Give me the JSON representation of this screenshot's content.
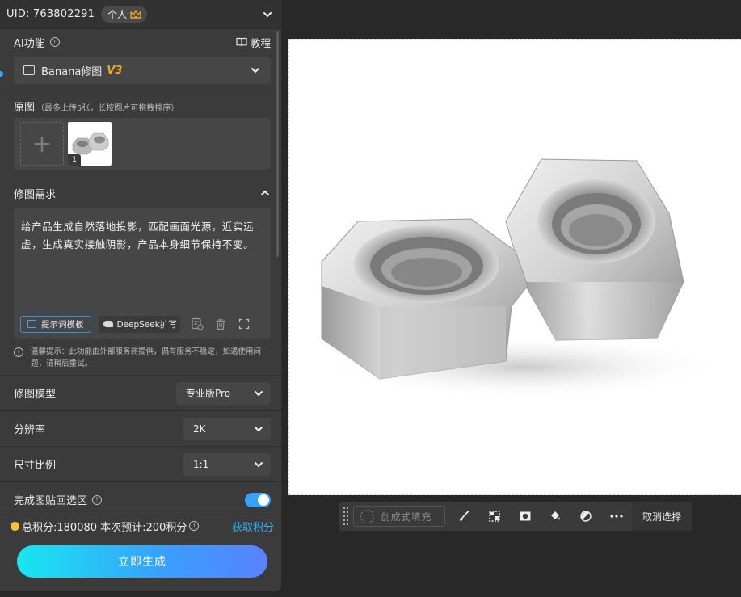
{
  "header": {
    "uid_text": "UID: 763802291",
    "badge_label": "个人"
  },
  "ai": {
    "title": "AI功能",
    "tutorial_label": "教程",
    "model_name": "Banana修图",
    "model_version": "V3"
  },
  "original": {
    "title": "原图",
    "hint": "（最多上传5张，长按图片可拖拽排序）",
    "images": [
      {
        "index": "1"
      }
    ]
  },
  "requirement": {
    "title": "修图需求",
    "text": "给产品生成自然落地投影，匹配画面光源，近实远虚，生成真实接触阴影，产品本身细节保持不变。",
    "template_label": "提示词模板",
    "deepseek_label": "DeepSeek扩写"
  },
  "notice": {
    "text": "温馨提示：此功能由外部服务商提供，偶有服务不稳定，如遇使用问题，请稍后重试。"
  },
  "options": {
    "model_label": "修图模型",
    "model_value": "专业版Pro",
    "resolution_label": "分辨率",
    "resolution_value": "2K",
    "ratio_label": "尺寸比例",
    "ratio_value": "1:1",
    "paste_back_label": "完成图贴回选区",
    "paste_back_on": true
  },
  "footer": {
    "points_text": "总积分:180080  本次预计:200积分",
    "get_points_label": "获取积分",
    "generate_label": "立即生成"
  },
  "toolbar": {
    "fill_label": "创成式填充",
    "cancel_label": "取消选择"
  },
  "colors": {
    "accent": "#3aa0ff",
    "version": "#f2a81d",
    "gradient_start": "#18e6ef",
    "gradient_end": "#5a82ff"
  }
}
